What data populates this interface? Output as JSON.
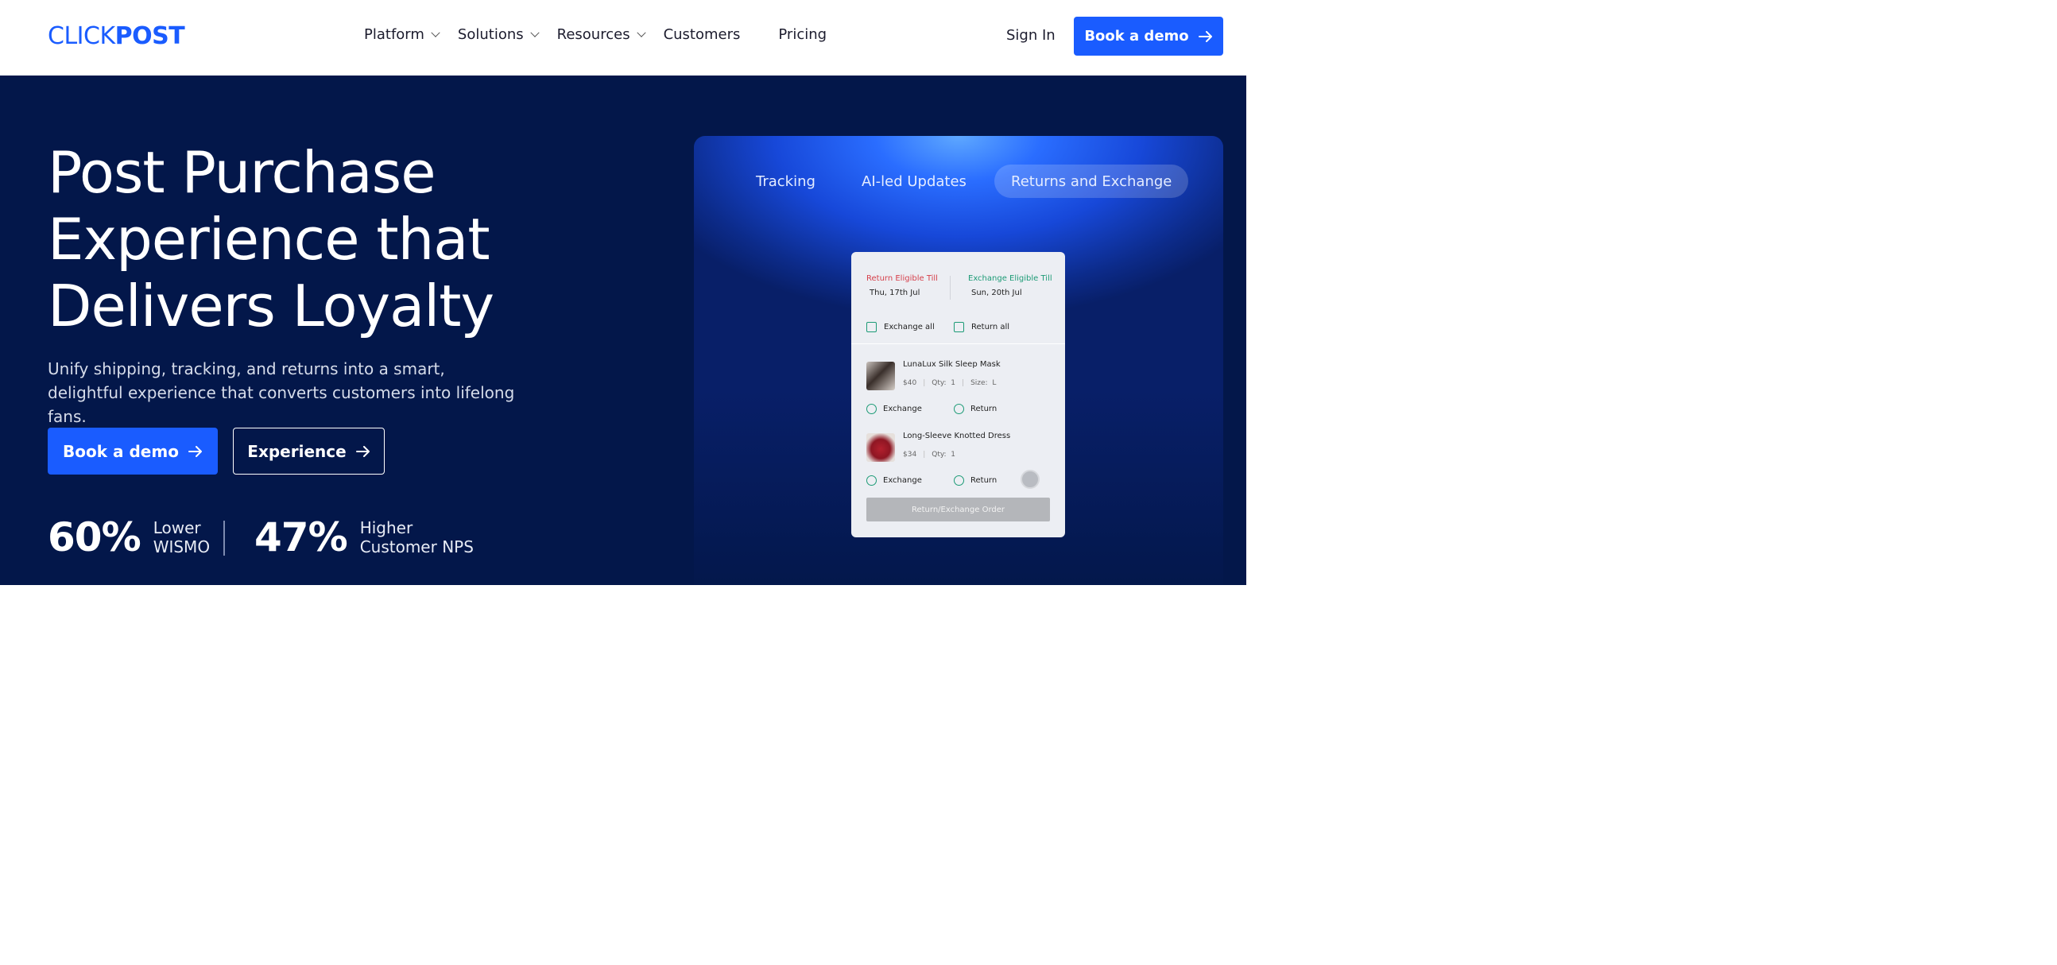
{
  "header": {
    "logo_light": "CLICK",
    "logo_bold": "POST",
    "nav": [
      "Platform",
      "Solutions",
      "Resources",
      "Customers",
      "Pricing"
    ],
    "signin": "Sign In",
    "cta": "Book a demo"
  },
  "hero": {
    "title_line1": "Post Purchase",
    "title_line2": "Experience that",
    "title_line3": "Delivers Loyalty",
    "subtitle": "Unify shipping, tracking, and returns into a smart, delightful experience that converts customers into lifelong fans.",
    "primary_cta": "Book a demo",
    "secondary_cta": "Experience",
    "stats": [
      {
        "value": "60%",
        "label_line1": "Lower",
        "label_line2": "WISMO"
      },
      {
        "value": "47%",
        "label_line1": "Higher",
        "label_line2": "Customer NPS"
      }
    ]
  },
  "showcase": {
    "tabs": [
      "Tracking",
      "AI-led Updates",
      "Returns and Exchange"
    ],
    "active_tab": "Returns and Exchange",
    "card": {
      "return_label": "Return Eligible Till",
      "return_date": "Thu, 17th Jul",
      "exchange_label": "Exchange Eligible Till",
      "exchange_date": "Sun, 20th Jul",
      "exchange_all": "Exchange all",
      "return_all": "Return all",
      "items": [
        {
          "name": "LunaLux Silk Sleep Mask",
          "price": "$40",
          "qty_label": "Qty:",
          "qty": "1",
          "size_label": "Size:",
          "size": "L"
        },
        {
          "name": "Long-Sleeve Knotted Dress",
          "price": "$34",
          "qty_label": "Qty:",
          "qty": "1"
        }
      ],
      "option_exchange": "Exchange",
      "option_return": "Return",
      "submit": "Return/Exchange Order"
    }
  },
  "colors": {
    "brand_blue": "#1a5cff",
    "hero_bg": "#03174a",
    "return_red": "#d6404b",
    "exchange_green": "#1d9b76"
  }
}
